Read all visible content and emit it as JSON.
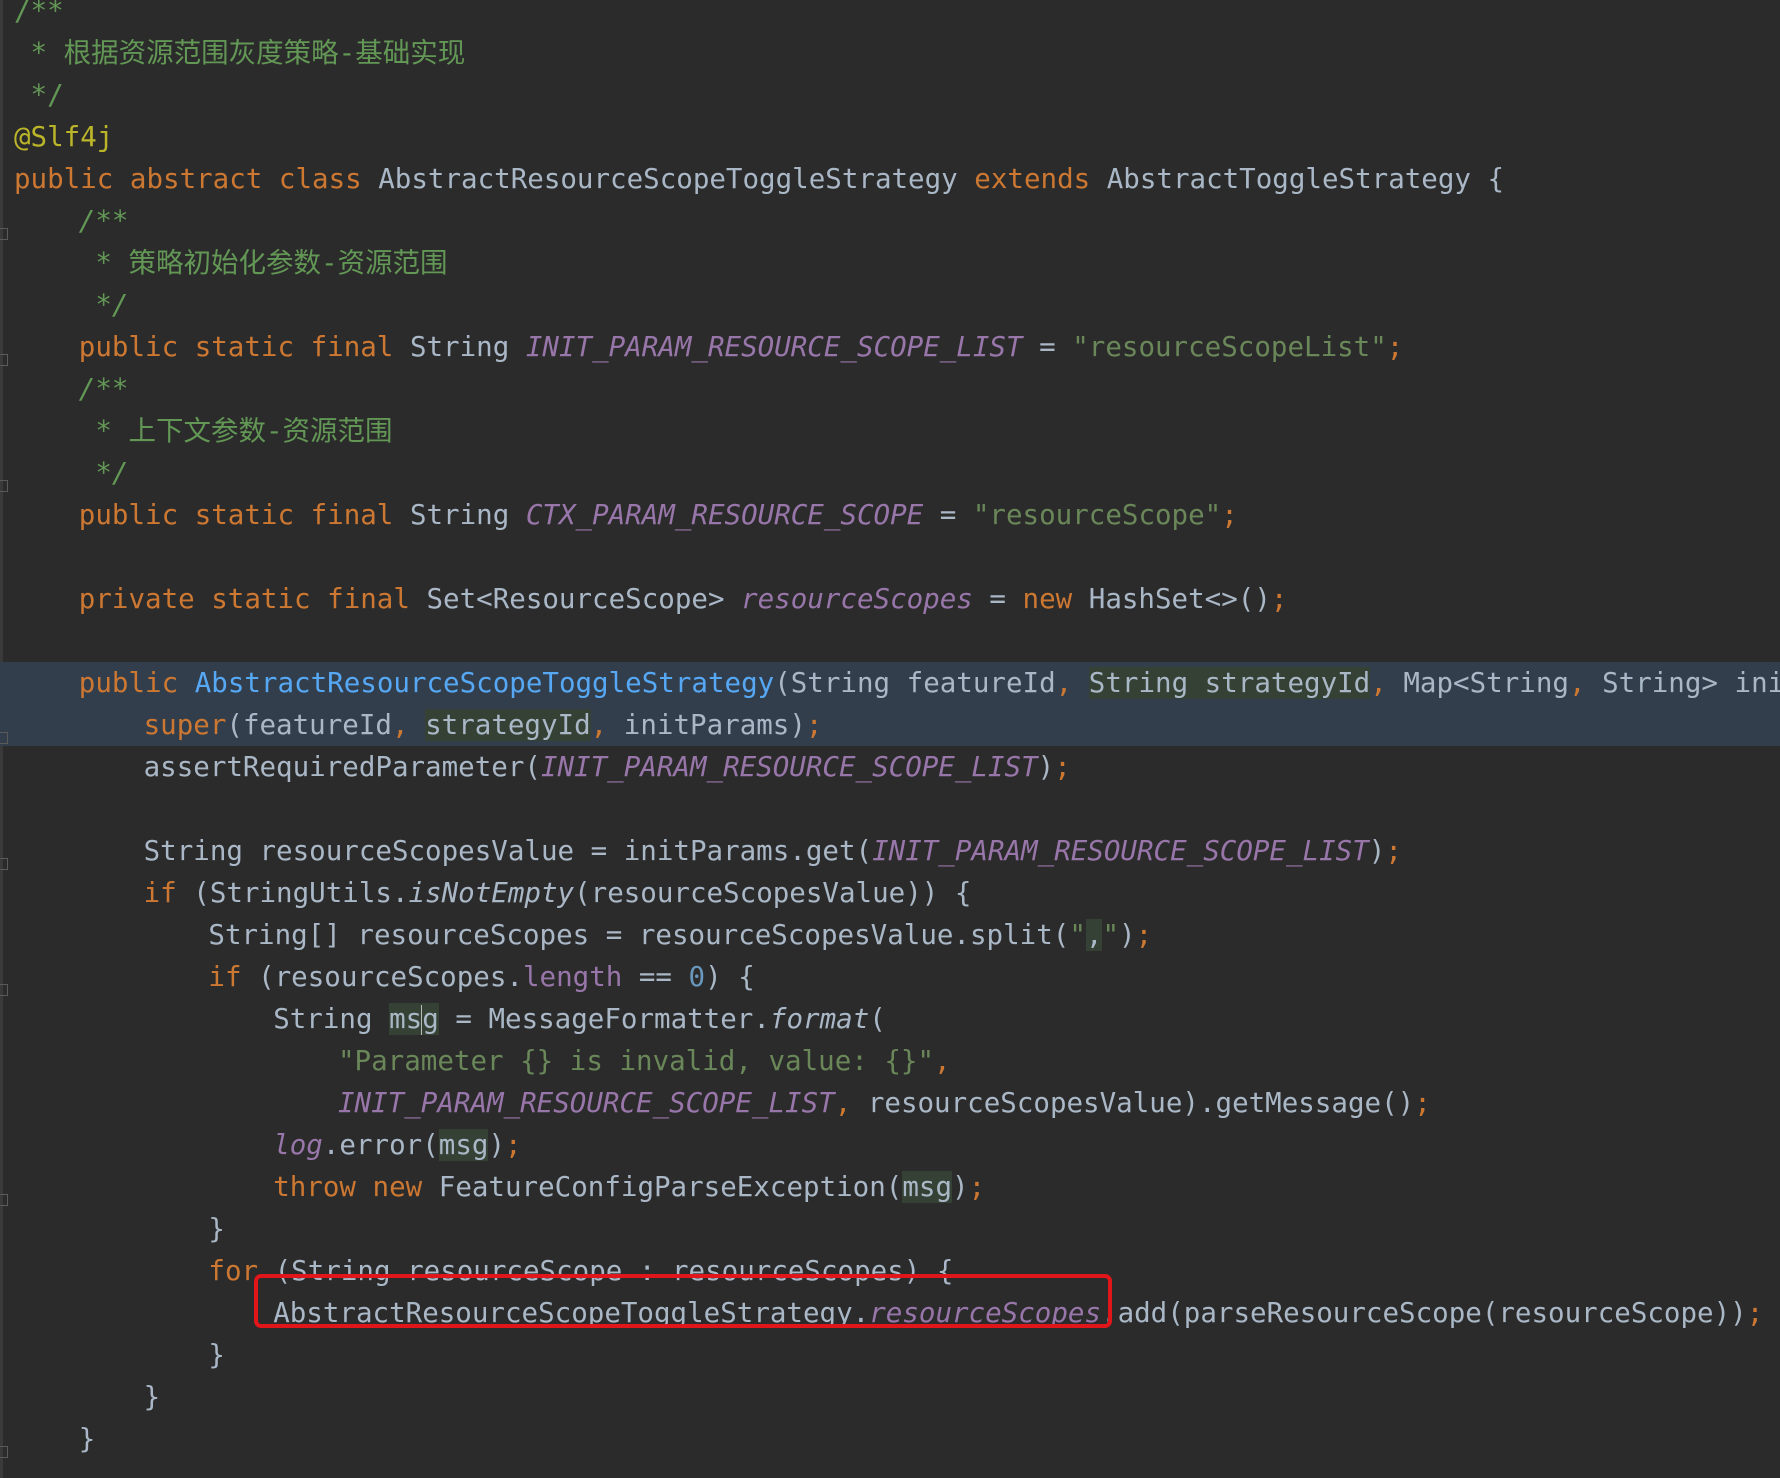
{
  "lines": [
    {
      "indent": 0,
      "hl": false,
      "tokens": [
        {
          "t": "/**",
          "c": "c-comment"
        }
      ]
    },
    {
      "indent": 0,
      "hl": false,
      "tokens": [
        {
          "t": " * 根据资源范围灰度策略-基础实现",
          "c": "c-comment"
        }
      ]
    },
    {
      "indent": 0,
      "hl": false,
      "tokens": [
        {
          "t": " */",
          "c": "c-comment"
        }
      ]
    },
    {
      "indent": 0,
      "hl": false,
      "tokens": [
        {
          "t": "@Slf4j",
          "c": "c-anno"
        }
      ]
    },
    {
      "indent": 0,
      "hl": false,
      "tokens": [
        {
          "t": "public abstract class ",
          "c": "c-kw"
        },
        {
          "t": "AbstractResourceScopeToggleStrategy ",
          "c": "c-plain"
        },
        {
          "t": "extends ",
          "c": "c-kw"
        },
        {
          "t": "AbstractToggleStrategy {",
          "c": "c-plain"
        }
      ]
    },
    {
      "indent": 4,
      "hl": false,
      "tokens": [
        {
          "t": "/**",
          "c": "c-doc"
        }
      ]
    },
    {
      "indent": 4,
      "hl": false,
      "tokens": [
        {
          "t": " * 策略初始化参数-资源范围",
          "c": "c-comment"
        }
      ]
    },
    {
      "indent": 4,
      "hl": false,
      "tokens": [
        {
          "t": " */",
          "c": "c-doc"
        }
      ]
    },
    {
      "indent": 4,
      "hl": false,
      "tokens": [
        {
          "t": "public static final ",
          "c": "c-kw"
        },
        {
          "t": "String ",
          "c": "c-plain"
        },
        {
          "t": "INIT_PARAM_RESOURCE_SCOPE_LIST",
          "c": "c-const"
        },
        {
          "t": " = ",
          "c": "c-plain"
        },
        {
          "t": "\"resourceScopeList\"",
          "c": "c-string"
        },
        {
          "t": ";",
          "c": "c-punct"
        }
      ]
    },
    {
      "indent": 4,
      "hl": false,
      "tokens": [
        {
          "t": "/**",
          "c": "c-doc"
        }
      ]
    },
    {
      "indent": 4,
      "hl": false,
      "tokens": [
        {
          "t": " * 上下文参数-资源范围",
          "c": "c-comment"
        }
      ]
    },
    {
      "indent": 4,
      "hl": false,
      "tokens": [
        {
          "t": " */",
          "c": "c-doc"
        }
      ]
    },
    {
      "indent": 4,
      "hl": false,
      "tokens": [
        {
          "t": "public static final ",
          "c": "c-kw"
        },
        {
          "t": "String ",
          "c": "c-plain"
        },
        {
          "t": "CTX_PARAM_RESOURCE_SCOPE",
          "c": "c-const"
        },
        {
          "t": " = ",
          "c": "c-plain"
        },
        {
          "t": "\"resourceScope\"",
          "c": "c-string"
        },
        {
          "t": ";",
          "c": "c-punct"
        }
      ]
    },
    {
      "indent": 0,
      "hl": false,
      "tokens": []
    },
    {
      "indent": 4,
      "hl": false,
      "tokens": [
        {
          "t": "private static final ",
          "c": "c-kw"
        },
        {
          "t": "Set<ResourceScope> ",
          "c": "c-plain"
        },
        {
          "t": "resourceScopes",
          "c": "c-const"
        },
        {
          "t": " = ",
          "c": "c-plain"
        },
        {
          "t": "new ",
          "c": "c-kw"
        },
        {
          "t": "HashSet<>()",
          "c": "c-plain"
        },
        {
          "t": ";",
          "c": "c-punct"
        }
      ]
    },
    {
      "indent": 0,
      "hl": false,
      "tokens": []
    },
    {
      "indent": 4,
      "hl": true,
      "tokens": [
        {
          "t": "public ",
          "c": "c-kw"
        },
        {
          "t": "AbstractResourceScopeToggleStrategy",
          "c": "c-method"
        },
        {
          "t": "(String featureId",
          "c": "c-plain"
        },
        {
          "t": ", ",
          "c": "c-punct"
        },
        {
          "t": "String strategyId",
          "c": "c-param"
        },
        {
          "t": ", ",
          "c": "c-punct"
        },
        {
          "t": "Map<String",
          "c": "c-plain"
        },
        {
          "t": ", ",
          "c": "c-punct"
        },
        {
          "t": "String> initParams) {",
          "c": "c-plain"
        }
      ]
    },
    {
      "indent": 8,
      "hl": true,
      "tokens": [
        {
          "t": "super",
          "c": "c-kw"
        },
        {
          "t": "(featureId",
          "c": "c-plain"
        },
        {
          "t": ", ",
          "c": "c-punct"
        },
        {
          "t": "strategyId",
          "c": "c-param"
        },
        {
          "t": ", ",
          "c": "c-punct"
        },
        {
          "t": "initParams)",
          "c": "c-plain"
        },
        {
          "t": ";",
          "c": "c-punct"
        }
      ]
    },
    {
      "indent": 8,
      "hl": false,
      "tokens": [
        {
          "t": "assertRequiredParameter(",
          "c": "c-plain"
        },
        {
          "t": "INIT_PARAM_RESOURCE_SCOPE_LIST",
          "c": "c-const"
        },
        {
          "t": ")",
          "c": "c-plain"
        },
        {
          "t": ";",
          "c": "c-punct"
        }
      ]
    },
    {
      "indent": 0,
      "hl": false,
      "tokens": []
    },
    {
      "indent": 8,
      "hl": false,
      "tokens": [
        {
          "t": "String resourceScopesValue = initParams.get(",
          "c": "c-plain"
        },
        {
          "t": "INIT_PARAM_RESOURCE_SCOPE_LIST",
          "c": "c-const"
        },
        {
          "t": ")",
          "c": "c-plain"
        },
        {
          "t": ";",
          "c": "c-punct"
        }
      ]
    },
    {
      "indent": 8,
      "hl": false,
      "tokens": [
        {
          "t": "if ",
          "c": "c-kw"
        },
        {
          "t": "(StringUtils.",
          "c": "c-plain"
        },
        {
          "t": "isNotEmpty",
          "c": "c-static"
        },
        {
          "t": "(resourceScopesValue)) {",
          "c": "c-plain"
        }
      ]
    },
    {
      "indent": 12,
      "hl": false,
      "tokens": [
        {
          "t": "String[] resourceScopes = resourceScopesValue.split(",
          "c": "c-plain"
        },
        {
          "t": "\"",
          "c": "c-string"
        },
        {
          "t": ",",
          "c": "c-param"
        },
        {
          "t": "\"",
          "c": "c-string"
        },
        {
          "t": ")",
          "c": "c-plain"
        },
        {
          "t": ";",
          "c": "c-punct"
        }
      ]
    },
    {
      "indent": 12,
      "hl": false,
      "tokens": [
        {
          "t": "if ",
          "c": "c-kw"
        },
        {
          "t": "(resourceScopes.",
          "c": "c-plain"
        },
        {
          "t": "length",
          "c": "c-field"
        },
        {
          "t": " == ",
          "c": "c-plain"
        },
        {
          "t": "0",
          "c": "c-num"
        },
        {
          "t": ") {",
          "c": "c-plain"
        }
      ]
    },
    {
      "indent": 16,
      "hl": false,
      "tokens": [
        {
          "t": "String ",
          "c": "c-plain"
        },
        {
          "t": "ms",
          "c": "c-ident-hl"
        },
        {
          "t": "|caret|",
          "c": "caret"
        },
        {
          "t": "g",
          "c": "c-ident-hl"
        },
        {
          "t": " = MessageFormatter.",
          "c": "c-plain"
        },
        {
          "t": "format",
          "c": "c-static"
        },
        {
          "t": "(",
          "c": "c-plain"
        }
      ]
    },
    {
      "indent": 20,
      "hl": false,
      "tokens": [
        {
          "t": "\"Parameter {} is invalid, value: {}\"",
          "c": "c-string"
        },
        {
          "t": ",",
          "c": "c-punct"
        }
      ]
    },
    {
      "indent": 20,
      "hl": false,
      "tokens": [
        {
          "t": "INIT_PARAM_RESOURCE_SCOPE_LIST",
          "c": "c-const"
        },
        {
          "t": ", ",
          "c": "c-punct"
        },
        {
          "t": "resourceScopesValue).getMessage()",
          "c": "c-plain"
        },
        {
          "t": ";",
          "c": "c-punct"
        }
      ]
    },
    {
      "indent": 16,
      "hl": false,
      "tokens": [
        {
          "t": "log",
          "c": "c-const"
        },
        {
          "t": ".error(",
          "c": "c-plain"
        },
        {
          "t": "msg",
          "c": "c-ident-hl"
        },
        {
          "t": ")",
          "c": "c-plain"
        },
        {
          "t": ";",
          "c": "c-punct"
        }
      ]
    },
    {
      "indent": 16,
      "hl": false,
      "tokens": [
        {
          "t": "throw new ",
          "c": "c-kw"
        },
        {
          "t": "FeatureConfigParseException(",
          "c": "c-plain"
        },
        {
          "t": "msg",
          "c": "c-ident-hl"
        },
        {
          "t": ")",
          "c": "c-plain"
        },
        {
          "t": ";",
          "c": "c-punct"
        }
      ]
    },
    {
      "indent": 12,
      "hl": false,
      "tokens": [
        {
          "t": "}",
          "c": "c-plain"
        }
      ]
    },
    {
      "indent": 12,
      "hl": false,
      "tokens": [
        {
          "t": "for ",
          "c": "c-kw"
        },
        {
          "t": "(String resourceScope : resourceScopes) {",
          "c": "c-plain"
        }
      ]
    },
    {
      "indent": 16,
      "hl": false,
      "tokens": [
        {
          "t": "AbstractResourceScopeToggleStrategy.",
          "c": "c-plain"
        },
        {
          "t": "resourceScopes",
          "c": "c-const"
        },
        {
          "t": ".add(parseResourceScope(resourceScope))",
          "c": "c-plain"
        },
        {
          "t": ";",
          "c": "c-punct"
        }
      ]
    },
    {
      "indent": 12,
      "hl": false,
      "tokens": [
        {
          "t": "}",
          "c": "c-plain"
        }
      ]
    },
    {
      "indent": 8,
      "hl": false,
      "tokens": [
        {
          "t": "}",
          "c": "c-plain"
        }
      ]
    },
    {
      "indent": 4,
      "hl": false,
      "tokens": [
        {
          "t": "}",
          "c": "c-plain"
        }
      ]
    }
  ],
  "colors": {
    "background": "#2b2b2b",
    "caret_line": "#323e4b",
    "keyword": "#cc7832",
    "comment": "#629755",
    "string": "#6a8759",
    "constant": "#9876aa",
    "annotation": "#bbb529",
    "method": "#56a8f5",
    "number": "#6897bb",
    "red_box": "#e0161a"
  }
}
